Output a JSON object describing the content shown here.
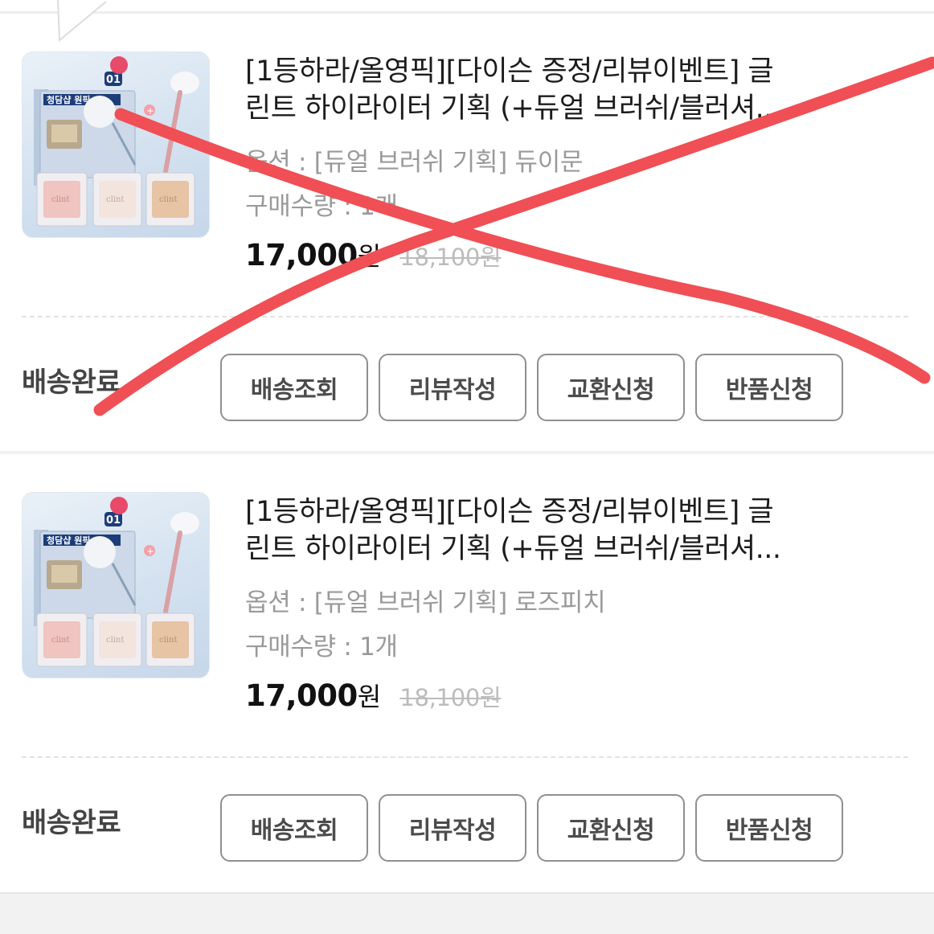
{
  "orders": [
    {
      "title": "[1등하라/올영픽][다이슨 증정/리뷰이벤트] 글",
      "title_line2": "린트 하이라이터 기획 (+듀얼 브러쉬/블러셔...",
      "option": "옵션 : [듀얼 브러쉬 기획] 듀이문",
      "quantity": "구매수량 : 1개",
      "price": "17,000",
      "currency": "원",
      "original_price": "18,100원",
      "status": "배송완료",
      "buttons": [
        "배송조회",
        "리뷰작성",
        "교환신청",
        "반품신청"
      ],
      "crossed_out": true,
      "thumbnail": {
        "headline": "청담샵 원픽",
        "number": "01",
        "brand": "clint"
      }
    },
    {
      "title": "[1등하라/올영픽][다이슨 증정/리뷰이벤트] 글",
      "title_line2": "린트 하이라이터 기획 (+듀얼 브러쉬/블러셔...",
      "option": "옵션 : [듀얼 브러쉬 기획] 로즈피치",
      "quantity": "구매수량 : 1개",
      "price": "17,000",
      "currency": "원",
      "original_price": "18,100원",
      "status": "배송완료",
      "buttons": [
        "배송조회",
        "리뷰작성",
        "교환신청",
        "반품신청"
      ],
      "crossed_out": false,
      "thumbnail": {
        "headline": "청담샵 원픽",
        "number": "01",
        "brand": "clint"
      }
    }
  ],
  "colors": {
    "cross_mark": "#ef4f55",
    "button_border": "#8f8f8f",
    "muted_text": "#9a9a9a"
  }
}
